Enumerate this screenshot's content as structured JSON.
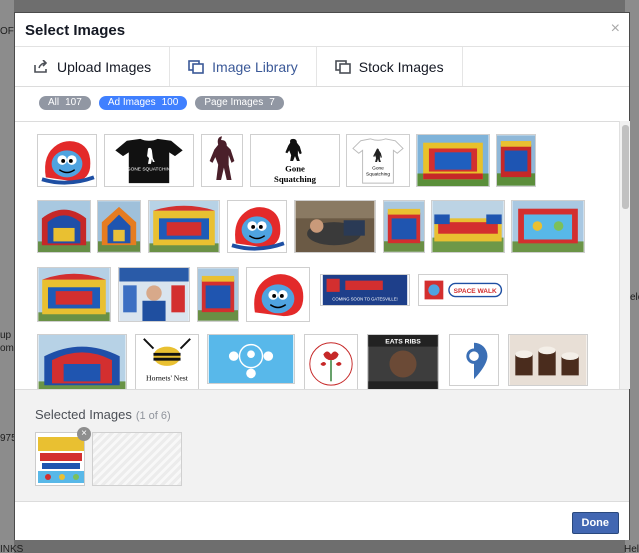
{
  "dialog": {
    "title": "Select Images",
    "close_glyph": "×"
  },
  "tabs": [
    {
      "label": "Upload Images",
      "icon": "upload-icon",
      "active": false
    },
    {
      "label": "Image Library",
      "icon": "library-icon",
      "active": true
    },
    {
      "label": "Stock Images",
      "icon": "stock-icon",
      "active": false
    }
  ],
  "filters": [
    {
      "label": "All",
      "count": "107",
      "active": false
    },
    {
      "label": "Ad Images",
      "count": "100",
      "active": true
    },
    {
      "label": "Page Images",
      "count": "7",
      "active": false
    }
  ],
  "thumb_texts": {
    "gone_squatchin": "GONE SQUATCHIN'",
    "gone": "Gone",
    "squatching": "Squatching",
    "gone_small": "Gone",
    "squatching_small": "Squatching",
    "coming_soon": "COMING SOON TO GATESVILLE!",
    "space_walk": "SPACE WALK",
    "hornets_nest": "Hornets' Nest",
    "eats_ribs": "EATS RIBS"
  },
  "selected": {
    "title": "Selected Images",
    "subtitle": "(1 of 6)",
    "remove_glyph": "×"
  },
  "footer": {
    "done_label": "Done"
  },
  "background": {
    "left_lines": [
      "OF",
      "up I",
      "omr",
      "975",
      "INKS"
    ],
    "right_lines": [
      "ele",
      "Hel"
    ]
  },
  "colors": {
    "accent": "#4080ff",
    "done_button": "#4267b2",
    "active_tab": "#3b5998"
  }
}
